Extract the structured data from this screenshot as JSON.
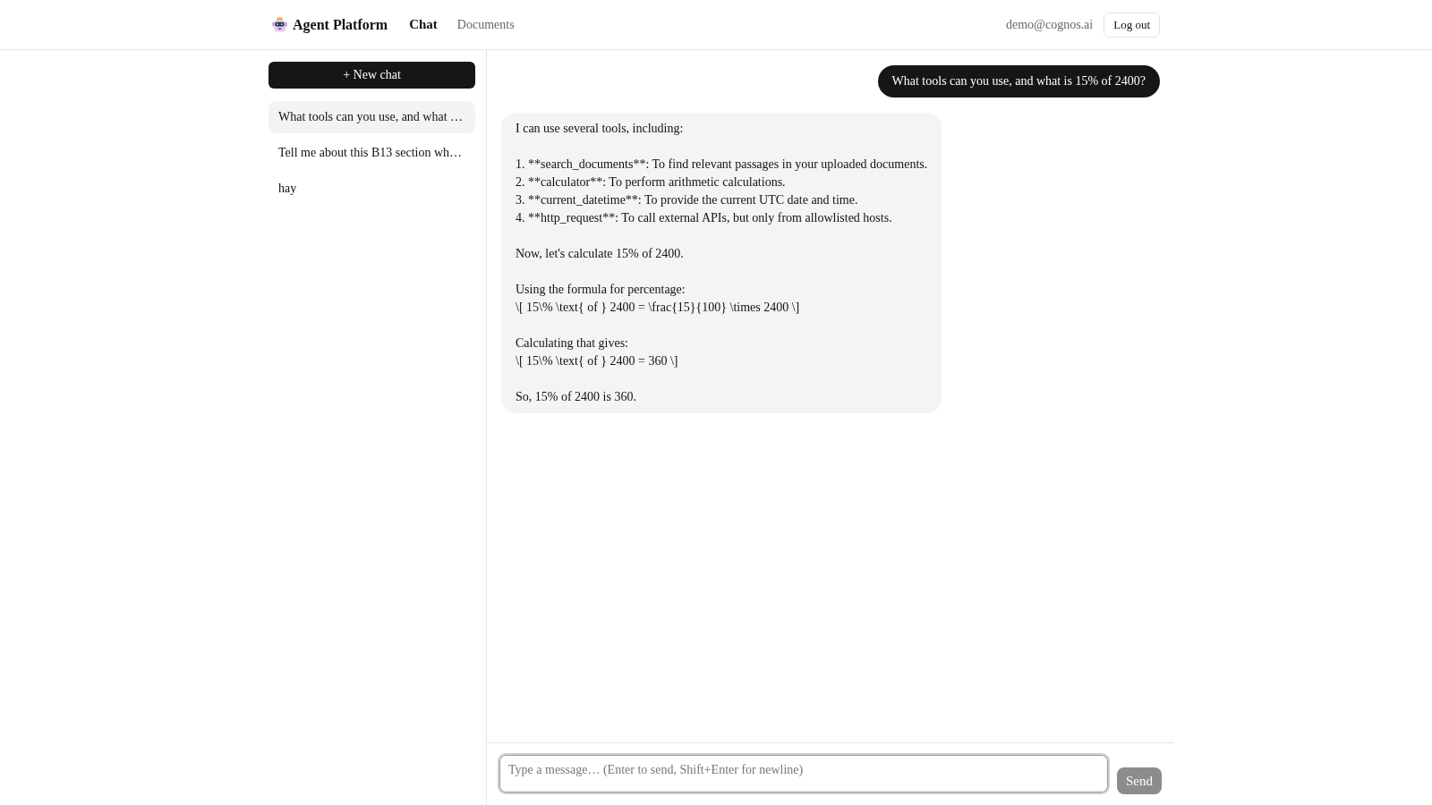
{
  "header": {
    "brand": "Agent Platform",
    "nav": [
      {
        "label": "Chat",
        "selected": true
      },
      {
        "label": "Documents",
        "selected": false
      }
    ],
    "user_email": "demo@cognos.ai",
    "logout_button": "Log out"
  },
  "sidebar": {
    "new_chat_button": "+ New chat",
    "conversations": [
      {
        "title": "What tools can you use, and what …",
        "selected": true
      },
      {
        "title": "Tell me about this B13 section wh…",
        "selected": false
      },
      {
        "title": "hay",
        "selected": false
      }
    ]
  },
  "chat": {
    "messages": [
      {
        "kind": "user",
        "text": "What tools can you use, and what is 15% of 2400?"
      },
      {
        "kind": "assistant",
        "text": "I can use several tools, including:\n\n1. **search_documents**: To find relevant passages in your uploaded documents.\n2. **calculator**: To perform arithmetic calculations.\n3. **current_datetime**: To provide the current UTC date and time.\n4. **http_request**: To call external APIs, but only from allowlisted hosts.\n\nNow, let's calculate 15% of 2400.\n\nUsing the formula for percentage:\n\\[ 15\\% \\text{ of } 2400 = \\frac{15}{100} \\times 2400 \\]\n\nCalculating that gives:\n\\[ 15\\% \\text{ of } 2400 = 360 \\]\n\nSo, 15% of 2400 is 360."
      }
    ]
  },
  "composer": {
    "placeholder": "Type a message… (Enter to send, Shift+Enter for newline)",
    "send_button": {
      "label": "Send",
      "disabled": true
    }
  }
}
